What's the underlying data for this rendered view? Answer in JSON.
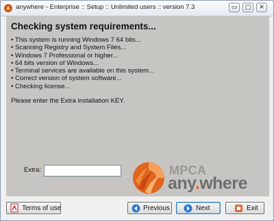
{
  "window": {
    "title": "anywhere - Enterprise :: Setup :: Unlimited users :: version 7.3",
    "controls": {
      "minimize": "▭",
      "maximize": "□",
      "close": "✕"
    }
  },
  "main": {
    "heading": "Checking system requirements...",
    "checks": [
      "This system is running Windows 7 64 bits...",
      "Scanning Registry and System Files...",
      "Windows 7 Professional or higher...",
      "64 bits version of Windows...",
      "Terminal services are available on this system...",
      "Correct version of system software...",
      "Checking license..."
    ],
    "prompt": "Please enter the Extra installation KEY.",
    "extra": {
      "label": "Extra:",
      "value": ""
    },
    "logo": {
      "top": "MPCA",
      "bottom_left": "any",
      "dot": ".",
      "bottom_right": "where"
    }
  },
  "footer": {
    "terms_label": "Terms of use",
    "previous_label": "Previous",
    "next_label": "Next",
    "exit_label": "Exit"
  },
  "colors": {
    "content_bg": "#c7c5c2",
    "logo_orange": "#e0651f",
    "logo_gray": "#6f6e6c"
  }
}
